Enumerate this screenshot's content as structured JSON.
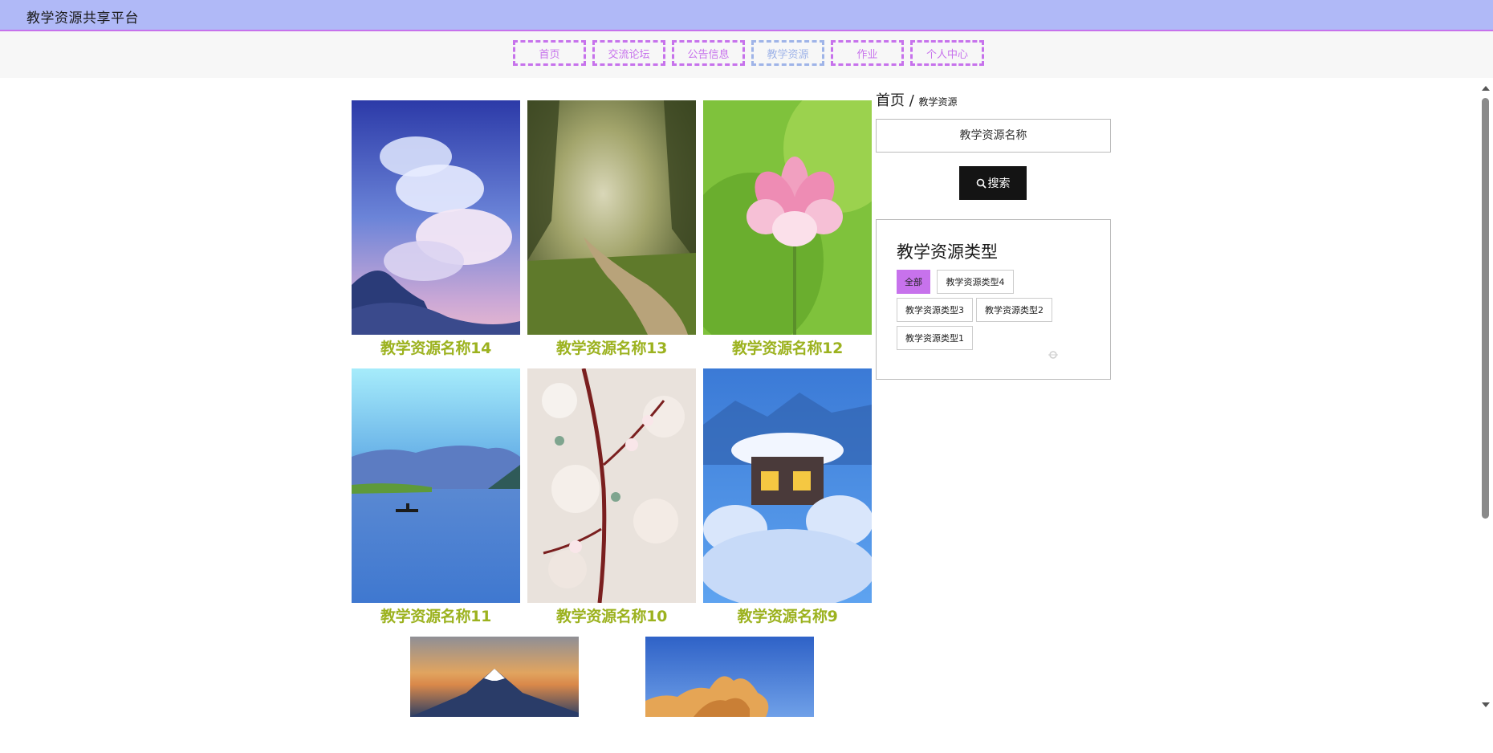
{
  "header": {
    "site_title": "教学资源共享平台"
  },
  "nav": {
    "items": [
      {
        "label": "首页",
        "active": false
      },
      {
        "label": "交流论坛",
        "active": false
      },
      {
        "label": "公告信息",
        "active": false
      },
      {
        "label": "教学资源",
        "active": true
      },
      {
        "label": "作业",
        "active": false
      },
      {
        "label": "个人中心",
        "active": false
      }
    ]
  },
  "breadcrumb": {
    "home": "首页",
    "separator": "/",
    "current": "教学资源"
  },
  "search": {
    "placeholder": "教学资源名称",
    "button_label": "搜索"
  },
  "types": {
    "title": "教学资源类型",
    "tags": [
      {
        "label": "全部",
        "active": true
      },
      {
        "label": "教学资源类型4",
        "active": false
      },
      {
        "label": "教学资源类型3",
        "active": false
      },
      {
        "label": "教学资源类型2",
        "active": false
      },
      {
        "label": "教学资源类型1",
        "active": false
      }
    ]
  },
  "resources": [
    {
      "name": "教学资源名称14",
      "image": "sky-clouds"
    },
    {
      "name": "教学资源名称13",
      "image": "forest-path"
    },
    {
      "name": "教学资源名称12",
      "image": "lotus-flower"
    },
    {
      "name": "教学资源名称11",
      "image": "lake-boat"
    },
    {
      "name": "教学资源名称10",
      "image": "blossom-branch"
    },
    {
      "name": "教学资源名称9",
      "image": "snow-cabin"
    }
  ],
  "more_resources": [
    {
      "image": "mountain-sunset"
    },
    {
      "image": "golden-rocks"
    }
  ],
  "colors": {
    "topbar": "#b0b9f7",
    "accent": "#c772ec",
    "caption": "#9cb21f",
    "nav_active": "#9fb4e8"
  }
}
